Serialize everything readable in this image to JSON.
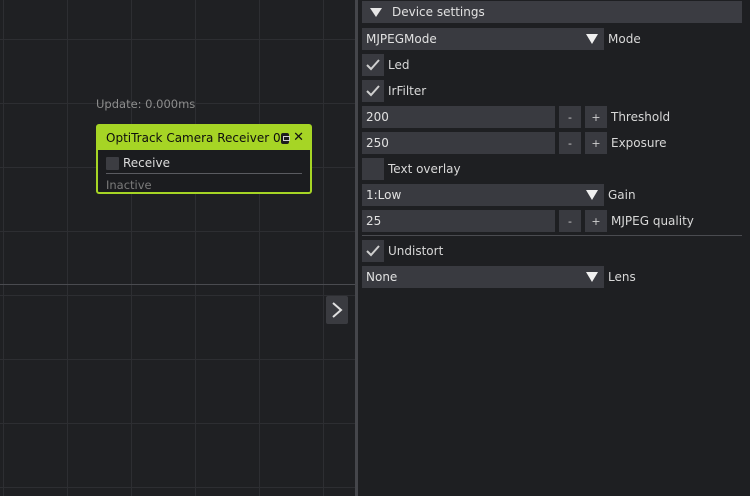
{
  "canvas": {
    "update_label": "Update: 0.000ms",
    "node": {
      "title": "OptiTrack Camera Receiver 0",
      "image_icon": "image-icon",
      "close_icon": "close-icon",
      "receive_label": "Receive",
      "receive_checked": false,
      "status": "Inactive",
      "accent_color": "#a6d525"
    },
    "expand_icon": "chevron-right-icon"
  },
  "panel": {
    "section_title": "Device settings",
    "mode": {
      "value": "MJPEGMode",
      "label": "Mode"
    },
    "led": {
      "label": "Led",
      "checked": true
    },
    "irfilter": {
      "label": "IrFilter",
      "checked": true
    },
    "threshold": {
      "value": "200",
      "label": "Threshold",
      "minus": "-",
      "plus": "+"
    },
    "exposure": {
      "value": "250",
      "label": "Exposure",
      "minus": "-",
      "plus": "+"
    },
    "text_overlay": {
      "label": "Text overlay",
      "checked": false
    },
    "gain": {
      "value": "1:Low",
      "label": "Gain"
    },
    "mjpeg_quality": {
      "value": "25",
      "label": "MJPEG quality",
      "minus": "-",
      "plus": "+"
    },
    "undistort": {
      "label": "Undistort",
      "checked": true
    },
    "lens": {
      "value": "None",
      "label": "Lens"
    }
  }
}
